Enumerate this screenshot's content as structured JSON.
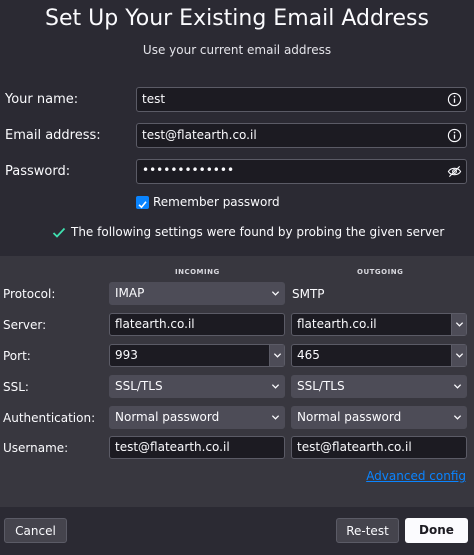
{
  "header": {
    "title": "Set Up Your Existing Email Address",
    "subtitle": "Use your current email address"
  },
  "form": {
    "name_label": "Your name:",
    "name_value": "test",
    "email_label": "Email address:",
    "email_value": "test@flatearth.co.il",
    "password_label": "Password:",
    "password_value": "•••••••••••••",
    "remember_label": "Remember password",
    "remember_checked": true
  },
  "status": {
    "found_message": "The following settings were found by probing the given server",
    "check_color": "#3fe1b0"
  },
  "settings": {
    "incoming_header": "INCOMING",
    "outgoing_header": "OUTGOING",
    "protocol_label": "Protocol:",
    "server_label": "Server:",
    "port_label": "Port:",
    "ssl_label": "SSL:",
    "auth_label": "Authentication:",
    "username_label": "Username:",
    "incoming": {
      "protocol": "IMAP",
      "server": "flatearth.co.il",
      "port": "993",
      "ssl": "SSL/TLS",
      "auth": "Normal password",
      "username": "test@flatearth.co.il"
    },
    "outgoing": {
      "protocol": "SMTP",
      "server": "flatearth.co.il",
      "port": "465",
      "ssl": "SSL/TLS",
      "auth": "Normal password",
      "username": "test@flatearth.co.il"
    },
    "advanced_link": "Advanced config"
  },
  "footer": {
    "cancel_label": "Cancel",
    "retest_label": "Re-test",
    "done_label": "Done"
  },
  "colors": {
    "background": "#2b2a33",
    "panel": "#38373f",
    "accent": "#0a84ff"
  }
}
